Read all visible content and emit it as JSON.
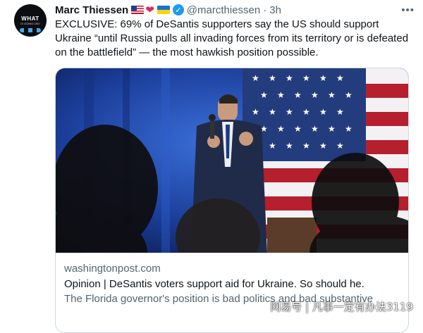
{
  "tweet": {
    "author_name": "Marc Thiessen",
    "name_emojis": [
      "us-flag-icon",
      "red-heart-icon",
      "ukraine-flag-icon"
    ],
    "handle": "@marcthiessen",
    "separator": "·",
    "time": "3h",
    "text": "EXCLUSIVE: 69% of DeSantis supporters say the US should support Ukraine “until Russia pulls all invading forces from its territory or is defeated on the battlefield” — the most hawkish position possible."
  },
  "avatar": {
    "line1": "WHAT",
    "line2": "IS GOING ON?"
  },
  "link_card": {
    "domain": "washingtonpost.com",
    "title": "Opinion | DeSantis voters support aid for Ukraine. So should he.",
    "description": "The Florida governor's position is bad politics and bad substantive"
  },
  "watermark": "网易号 | 凡事一定有办法3119",
  "colors": {
    "accent": "#1d9bf0",
    "secondary_text": "#536471",
    "border": "#cfd9de"
  }
}
